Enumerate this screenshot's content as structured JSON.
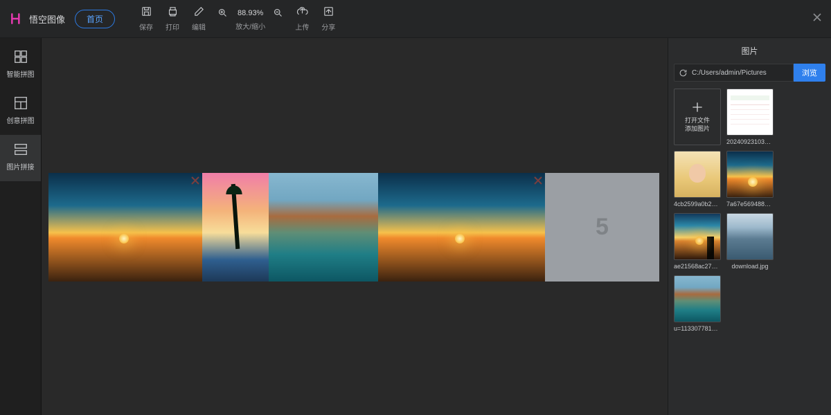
{
  "app_name": "悟空图像",
  "home_label": "首页",
  "toolbar": {
    "save": "保存",
    "print": "打印",
    "edit": "编辑",
    "zoom_pct": "88.93%",
    "zoom_label": "放大/缩小",
    "upload": "上传",
    "share": "分享"
  },
  "left_rail": [
    {
      "label": "智能拼图"
    },
    {
      "label": "创意拼图"
    },
    {
      "label": "图片拼接"
    }
  ],
  "canvas": {
    "placeholder_number": "5"
  },
  "right_panel": {
    "title": "图片",
    "path": "C:/Users/admin/Pictures",
    "browse_label": "浏览",
    "add_tile_line1": "打开文件",
    "add_tile_line2": "添加图片",
    "thumbs": [
      {
        "label": "2024092310340..."
      },
      {
        "label": "4cb2599a0b2a89e..."
      },
      {
        "label": "7a67e56948809fd..."
      },
      {
        "label": "ae21568ac27ea8e..."
      },
      {
        "label": "download.jpg"
      },
      {
        "label": "u=1133077813,61..."
      }
    ]
  }
}
